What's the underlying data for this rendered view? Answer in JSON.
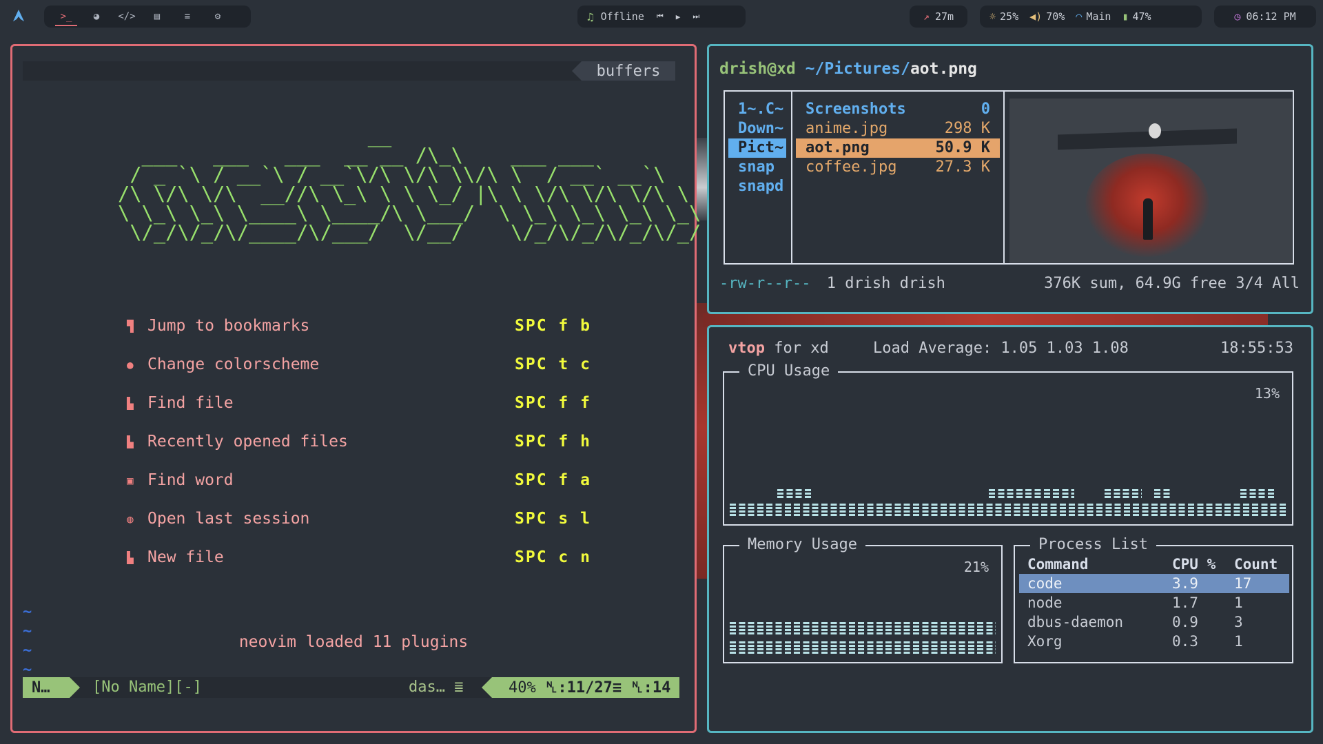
{
  "topbar": {
    "workspaces": [
      {
        "icon": "terminal-icon",
        "glyph": ">_"
      },
      {
        "icon": "firefox-icon",
        "glyph": "◕"
      },
      {
        "icon": "code-icon",
        "glyph": "</>"
      },
      {
        "icon": "chat-icon",
        "glyph": "▤"
      },
      {
        "icon": "notes-icon",
        "glyph": "≡"
      },
      {
        "icon": "settings-icon",
        "glyph": "⚙"
      }
    ],
    "media": {
      "status": "Offline",
      "prev": "⏮",
      "play": "▶",
      "next": "⏭"
    },
    "uptime": "27m",
    "brightness": "25%",
    "volume": "70%",
    "network": "Main",
    "battery": "47%",
    "clock": "06:12 PM"
  },
  "nvim": {
    "tab_label": "buffers",
    "ascii_logo": "                     __\n  ___   ___   ___  __ __ /\\_\\    ___ ___\n / _ `\\ / __`\\ / __`\\/\\ \\/\\ \\\\/\\ \\  / __` __`\\\n/\\ \\/\\ \\/\\  __//\\ \\_\\ \\ \\ \\_/ |\\ \\ \\/\\ \\/\\ \\/\\ \\\n\\ \\_\\ \\_\\ \\____\\ \\____/\\ \\___/  \\ \\_\\ \\_\\ \\_\\ \\_\\\n \\/_/\\/_/\\/____/\\/___/  \\/__/    \\/_/\\/_/\\/_/\\/_/",
    "menu": [
      {
        "icon": "bookmark-icon",
        "glyph": "🔖",
        "label": "Jump to bookmarks",
        "keys": "SPC f b"
      },
      {
        "icon": "palette-icon",
        "glyph": "●",
        "label": "Change colorscheme",
        "keys": "SPC t c"
      },
      {
        "icon": "file-icon",
        "glyph": "▙",
        "label": "Find file",
        "keys": "SPC f f"
      },
      {
        "icon": "recent-files-icon",
        "glyph": "▙",
        "label": "Recently opened files",
        "keys": "SPC f h"
      },
      {
        "icon": "word-icon",
        "glyph": "▣",
        "label": "Find word",
        "keys": "SPC f a"
      },
      {
        "icon": "session-icon",
        "glyph": "◍",
        "label": "Open last session",
        "keys": "SPC s l"
      },
      {
        "icon": "new-file-icon",
        "glyph": "▙",
        "label": "New file",
        "keys": "SPC c n"
      }
    ],
    "footer": "neovim loaded 11 plugins",
    "tildes": [
      "~",
      "~",
      "~",
      "~"
    ],
    "status": {
      "mode": "N…",
      "filename": "[No Name][-]",
      "filetype": "das…  ≣",
      "percent": "40%",
      "line": "␤:11/27≡",
      "col": "␤:14"
    }
  },
  "ranger": {
    "host": "drish@xd",
    "path": " ~/Pictures/",
    "file": "aot.png",
    "parent_items": [
      "1~.C~",
      "Down~",
      "Pict~",
      "snap",
      "snapd"
    ],
    "parent_selected": 2,
    "files": [
      {
        "name": "Screenshots",
        "size": "0",
        "type": "dir"
      },
      {
        "name": "anime.jpg",
        "size": "298 K",
        "type": "file"
      },
      {
        "name": "aot.png",
        "size": "50.9 K",
        "type": "selected"
      },
      {
        "name": "coffee.jpg",
        "size": "27.3 K",
        "type": "file"
      }
    ],
    "status": {
      "perms": "-rw-r--r--",
      "owner": "1 drish drish",
      "summary": "376K sum, 64.9G free   3/4   All"
    }
  },
  "vtop": {
    "name": "vtop",
    "host_text": " for xd",
    "load": "Load Average: 1.05 1.03 1.08",
    "time": "18:55:53",
    "cpu": {
      "title": "CPU Usage",
      "percent": "13%",
      "value": 0.13
    },
    "memory": {
      "title": "Memory Usage",
      "percent": "21%",
      "value": 0.21
    },
    "process": {
      "title": "Process List",
      "headers": [
        "Command",
        "CPU %",
        "Count"
      ],
      "rows": [
        {
          "cmd": "code",
          "cpu": "3.9",
          "count": "17"
        },
        {
          "cmd": "node",
          "cpu": "1.7",
          "count": "1"
        },
        {
          "cmd": "dbus-daemon",
          "cpu": "0.9",
          "count": "3"
        },
        {
          "cmd": "Xorg",
          "cpu": "0.3",
          "count": "1"
        }
      ]
    }
  },
  "colors": {
    "nvim_border": "#e06c75",
    "ranger_border": "#56b6c2",
    "accent_green": "#98c379",
    "accent_yellow": "#f1fa3c",
    "accent_blue": "#61afef"
  }
}
